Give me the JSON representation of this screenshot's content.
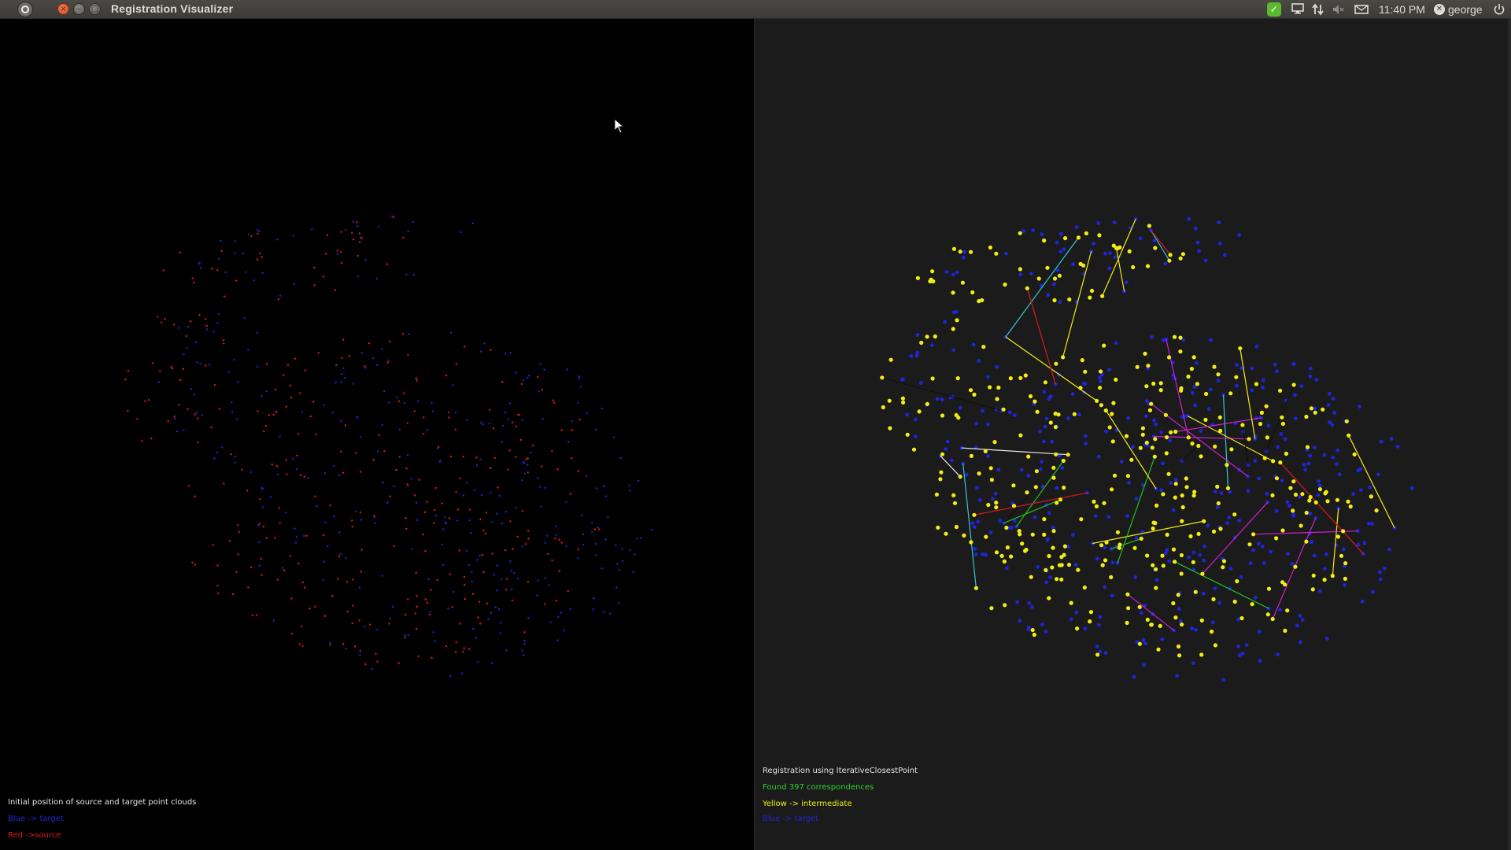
{
  "window": {
    "title": "Registration Visualizer"
  },
  "top_panel": {
    "clock": "11:40 PM",
    "username": "george",
    "indicators": [
      "update-check-icon",
      "display-icon",
      "network-icon",
      "volume-muted-icon",
      "mail-icon",
      "user-status-icon",
      "power-icon"
    ]
  },
  "left_viewport": {
    "caption": "Initial position of source and target point clouds",
    "legend_blue": "Blue -> target",
    "legend_red": "Red  ->source"
  },
  "right_viewport": {
    "caption": "Registration using IterativeClosestPoint",
    "status": "Found 397 correspondences",
    "legend_yellow": "Yellow -> intermediate",
    "legend_blue": "Blue  -> target"
  },
  "colors": {
    "target": "#1f25d8",
    "source": "#e01818",
    "intermediate": "#f2ee14",
    "status_text": "#30d030",
    "caption_text": "#e6e6e6",
    "correspondence_lines": [
      "#e01818",
      "#22c022",
      "#30c8d0",
      "#d020d0",
      "#e8e8e8",
      "#101010",
      "#f2ee14"
    ]
  }
}
